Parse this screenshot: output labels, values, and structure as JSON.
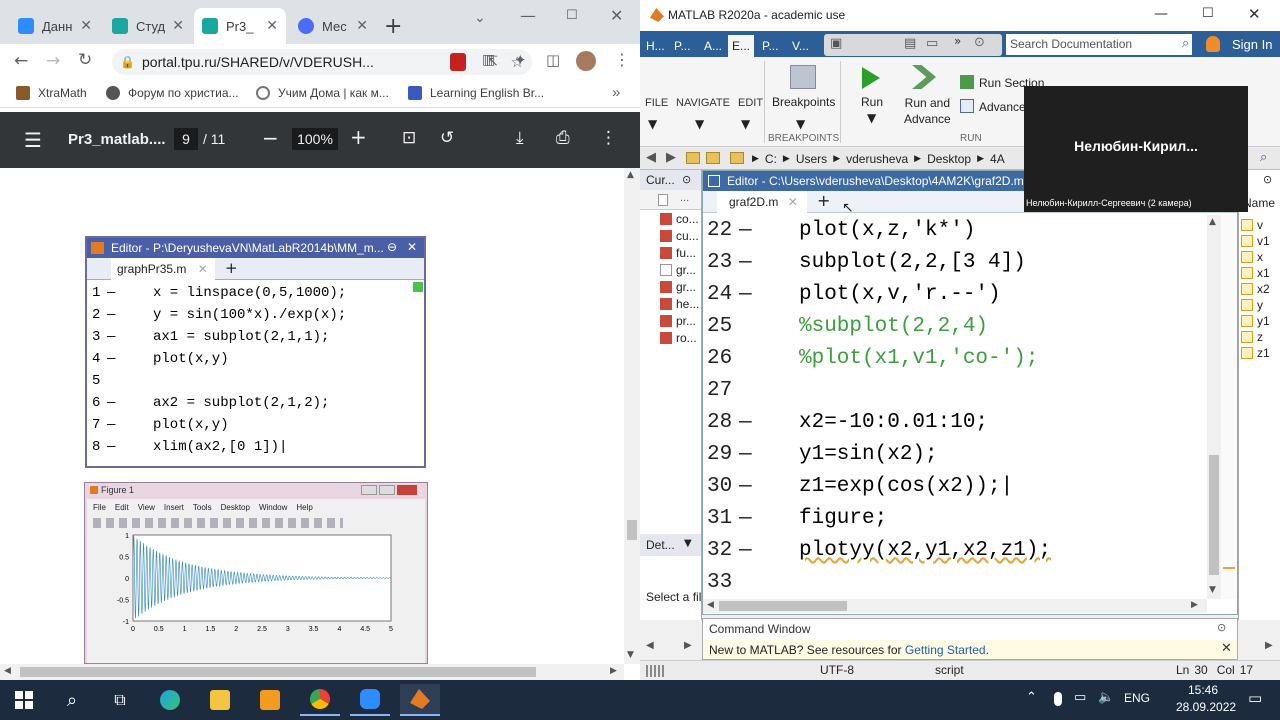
{
  "chrome": {
    "tabs": [
      {
        "label": "Данн",
        "color": "#2d8cff"
      },
      {
        "label": "Студ",
        "color": "#1aa7a0"
      },
      {
        "label": "Pr3_",
        "color": "#1aa7a0"
      },
      {
        "label": "Мес",
        "color": "#4a6cf7"
      }
    ],
    "new_tab": "+",
    "url": "portal.tpu.ru/SHARED/v/VDERUSH...",
    "bookmarks": [
      {
        "label": "XtraMath",
        "color": "#8b5a2b"
      },
      {
        "label": "Форум по христиа...",
        "color": "#555"
      },
      {
        "label": "Учим Дома | как м...",
        "color": "#777"
      },
      {
        "label": "Learning English Br...",
        "color": "#3a5bbd"
      }
    ],
    "bookmark_overflow": "»",
    "pdf": {
      "filename": "Pr3_matlab....",
      "page_current": "9",
      "page_total": "/ 11",
      "zoom": "100%"
    },
    "editor_image": {
      "title": "Editor - P:\\DeryushevaVN\\MatLabR2014b\\MM_m...",
      "tab": "graphPr35.m",
      "lines": [
        {
          "n": "1",
          "code": "x = linspace(0,5,1000);"
        },
        {
          "n": "2",
          "code": "y = sin(100*x)./exp(x);"
        },
        {
          "n": "3",
          "code": "ax1 = subplot(2,1,1);"
        },
        {
          "n": "4",
          "code": "plot(x,y)"
        },
        {
          "n": "5",
          "code": ""
        },
        {
          "n": "6",
          "code": "ax2 = subplot(2,1,2);"
        },
        {
          "n": "7",
          "code": "plot(x,y)"
        },
        {
          "n": "8",
          "code": "xlim(ax2,[0 1])|"
        }
      ]
    },
    "figure_image": {
      "title": "Figure 1",
      "menu": [
        "File",
        "Edit",
        "View",
        "Insert",
        "Tools",
        "Desktop",
        "Window",
        "Help"
      ],
      "yticks": [
        "1",
        "0.5",
        "0",
        "-0.5",
        "-1"
      ],
      "xticks": [
        "0",
        "0.5",
        "1",
        "1.5",
        "2",
        "2.5",
        "3",
        "3.5",
        "4",
        "4.5",
        "5"
      ]
    }
  },
  "matlab": {
    "title": "MATLAB R2020a - academic use",
    "ribbon_tabs": [
      "H...",
      "P...",
      "A...",
      "V...",
      "P...",
      "V..."
    ],
    "search_placeholder": "Search Documentation",
    "sign_in": "Sign In",
    "ribbon": {
      "file": "FILE",
      "navigate": "NAVIGATE",
      "edit": "EDIT",
      "breakpoints": "Breakpoints",
      "breakpoints_group": "BREAKPOINTS",
      "run": "Run",
      "run_and_advance": "Run and\nAdvance",
      "run_section": "Run Section",
      "advance": "Advance",
      "run_group": "RUN"
    },
    "address": [
      "C:",
      "Users",
      "vderusheva",
      "Desktop",
      "4A"
    ],
    "current_folder": {
      "label": "Cur...",
      "files": [
        "co...",
        "cu...",
        "fu...",
        "gr...",
        "gr...",
        "he...",
        "pr...",
        "ro..."
      ],
      "details": "Det...",
      "select_hint": "Select a fil"
    },
    "editor": {
      "title": "Editor - C:\\Users\\vderusheva\\Desktop\\4AM2K\\graf2D.m",
      "tab": "graf2D.m",
      "lines": [
        {
          "n": "22",
          "code": "plot(x,z,'k*')",
          "comment": false
        },
        {
          "n": "23",
          "code": "subplot(2,2,[3 4])",
          "comment": false
        },
        {
          "n": "24",
          "code": "plot(x,v,'r.--')",
          "comment": false
        },
        {
          "n": "25",
          "code": "%subplot(2,2,4)",
          "comment": true
        },
        {
          "n": "26",
          "code": "%plot(x1,v1,'co-');",
          "comment": true
        },
        {
          "n": "27",
          "code": "",
          "comment": false
        },
        {
          "n": "28",
          "code": "x2=-10:0.01:10;",
          "comment": false
        },
        {
          "n": "29",
          "code": "y1=sin(x2);",
          "comment": false
        },
        {
          "n": "30",
          "code": "z1=exp(cos(x2));|",
          "comment": false
        },
        {
          "n": "31",
          "code": "figure;",
          "comment": false
        },
        {
          "n": "32",
          "code": "plotyy(x2,y1,x2,z1);",
          "comment": false
        },
        {
          "n": "33",
          "code": "",
          "comment": false
        }
      ]
    },
    "workspace": {
      "label": "Name",
      "vars": [
        "v",
        "v1",
        "x",
        "x1",
        "x2",
        "y",
        "y1",
        "z",
        "z1"
      ]
    },
    "command_window": {
      "title": "Command Window",
      "message": "New to MATLAB? See resources for ",
      "link": "Getting Started",
      "tail": "."
    },
    "status": {
      "encoding": "UTF-8",
      "type": "script",
      "ln_label": "Ln",
      "ln": "30",
      "col_label": "Col",
      "col": "17"
    }
  },
  "video": {
    "name": "Нелюбин-Кирил...",
    "caption": "Нелюбин-Кирилл-Сергеевич (2 камера)"
  },
  "taskbar": {
    "lang": "ENG",
    "time": "15:46",
    "date": "28.09.2022"
  }
}
